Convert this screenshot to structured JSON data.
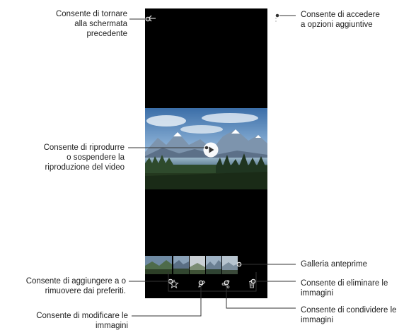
{
  "callouts": {
    "back": [
      "Consente di tornare",
      "alla schermata",
      "precedente"
    ],
    "more": [
      "Consente di accedere",
      "a opzioni aggiuntive"
    ],
    "play": [
      "Consente di riprodurre",
      "o sospendere la",
      "riproduzione del video"
    ],
    "gallery": [
      "Galleria anteprime"
    ],
    "favorite": [
      "Consente di aggiungere a o",
      "rimuovere dai preferiti."
    ],
    "delete": [
      "Consente di eliminare le",
      "immagini"
    ],
    "share": [
      "Consente di condividere le",
      "immagini"
    ],
    "edit": [
      "Consente di modificare le",
      "immagini"
    ]
  },
  "icons": {
    "back": "arrow-left-icon",
    "more": "more-vertical-icon",
    "play": "play-icon",
    "favorite": "star-icon",
    "edit": "pencil-icon",
    "share": "share-icon",
    "delete": "trash-icon"
  },
  "colors": {
    "line": "#333333",
    "phone": "#000000",
    "icon": "#cccccc"
  }
}
